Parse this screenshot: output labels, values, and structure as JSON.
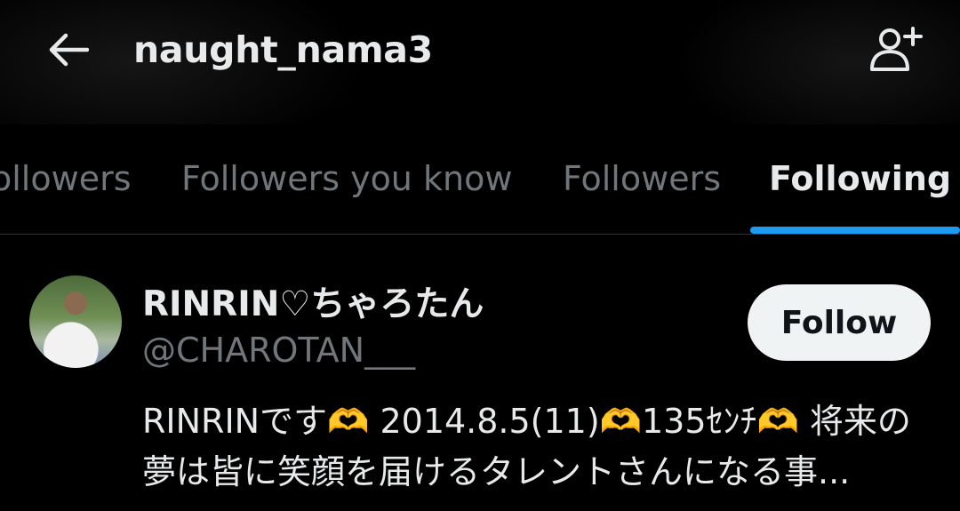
{
  "header": {
    "back_icon": "arrow-left-icon",
    "title": "naught_nama3",
    "add_user_icon": "add-user-icon"
  },
  "tabs": [
    {
      "label": "ollowers",
      "active": false
    },
    {
      "label": "Followers you know",
      "active": false
    },
    {
      "label": "Followers",
      "active": false
    },
    {
      "label": "Following",
      "active": true
    }
  ],
  "accent_color": "#1d9bf0",
  "user": {
    "display_name": "RINRIN♡ちゃろたん",
    "handle": "@CHAROTAN___",
    "follow_label": "Follow",
    "bio_line1": "RINRINです🫶 2014.8.5(11)🫶135ｾﾝﾁ🫶 将来の",
    "bio_line2": "夢は皆に笑顔を届けるタレントさんになる事..."
  }
}
